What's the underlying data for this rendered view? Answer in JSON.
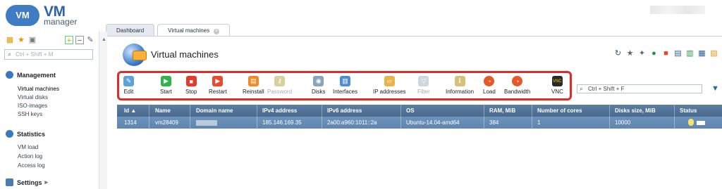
{
  "header": {
    "logo_badge": "VM",
    "logo_vm": "VM",
    "logo_manager": "manager"
  },
  "tabs": [
    {
      "label": "Dashboard"
    },
    {
      "label": "Virtual machines",
      "close": "×"
    }
  ],
  "sidebar": {
    "search_placeholder": "Ctrl + Shift + M",
    "sections": [
      {
        "title": "Management",
        "icon": "management-icon",
        "color": "#3b78c2",
        "items": [
          {
            "label": "Virtual machines"
          },
          {
            "label": "Virtual disks"
          },
          {
            "label": "ISO-images"
          },
          {
            "label": "SSH keys"
          }
        ]
      },
      {
        "title": "Statistics",
        "icon": "statistics-icon",
        "color": "#3b78c2",
        "items": [
          {
            "label": "VM load"
          },
          {
            "label": "Action log"
          },
          {
            "label": "Access log"
          }
        ]
      },
      {
        "title": "Settings",
        "icon": "settings-icon",
        "color": "#4a79b3",
        "expand_glyph": "▸"
      }
    ]
  },
  "page": {
    "title": "Virtual machines"
  },
  "toolbar": {
    "items": [
      {
        "label": "Edit",
        "icon": "edit-icon",
        "color": "#5da3d8",
        "enabled": true
      },
      {
        "label": "Start",
        "icon": "start-icon",
        "color": "#2fb34a",
        "enabled": true
      },
      {
        "label": "Stop",
        "icon": "stop-icon",
        "color": "#e23b2d",
        "enabled": true
      },
      {
        "label": "Restart",
        "icon": "restart-icon",
        "color": "#e84b2f",
        "enabled": true
      },
      {
        "label": "Reinstall",
        "icon": "reinstall-icon",
        "color": "#f08a24",
        "enabled": true
      },
      {
        "label": "Password",
        "icon": "password-icon",
        "color": "#d9d0a0",
        "enabled": false
      },
      {
        "label": "Disks",
        "icon": "disks-icon",
        "color": "#8aa3bd",
        "enabled": true
      },
      {
        "label": "Interfaces",
        "icon": "interfaces-icon",
        "color": "#4b8fd0",
        "enabled": true
      },
      {
        "label": "IP addresses",
        "icon": "ip-addresses-icon",
        "color": "#e8b34c",
        "enabled": true
      },
      {
        "label": "Filter",
        "icon": "filter-icon",
        "color": "#cfd6de",
        "enabled": false
      },
      {
        "label": "Information",
        "icon": "information-icon",
        "color": "#d7c07a",
        "enabled": true
      },
      {
        "label": "Load",
        "icon": "load-icon",
        "color": "#e65a2a",
        "enabled": true
      },
      {
        "label": "Bandwidth",
        "icon": "bandwidth-icon",
        "color": "#e6582b",
        "enabled": true
      },
      {
        "label": "VNC",
        "icon": "vnc-icon",
        "color": "#2a2a2a",
        "badge": "VNC",
        "enabled": true
      }
    ],
    "filter_value": "Ctrl + Shift + F"
  },
  "table": {
    "columns": [
      "Id ▲",
      "Name",
      "Domain name",
      "IPv4 address",
      "IPv6 address",
      "OS",
      "RAM, MiB",
      "Number of cores",
      "Disks size, MiB",
      "Status"
    ],
    "rows": [
      [
        "1314",
        "vm28409",
        "",
        "185.146.169.35",
        "2a00:a960:1011::2a",
        "Ubuntu-14.04-amd64",
        "384",
        "1",
        "10000",
        ""
      ]
    ]
  }
}
